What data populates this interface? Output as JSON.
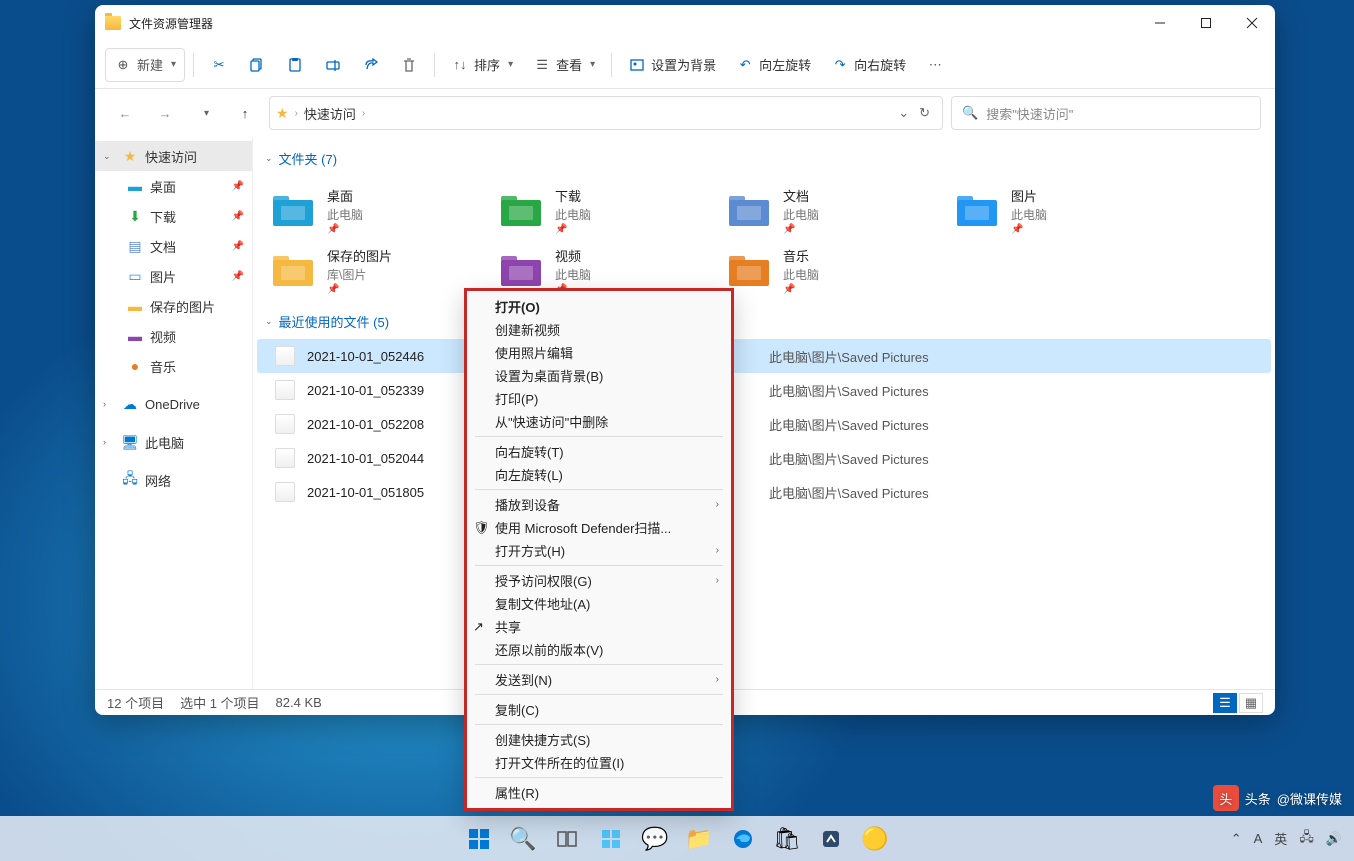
{
  "window": {
    "title": "文件资源管理器"
  },
  "toolbar": {
    "new": "新建",
    "sort": "排序",
    "view": "查看",
    "set_bg": "设置为背景",
    "rotate_left": "向左旋转",
    "rotate_right": "向右旋转"
  },
  "breadcrumb": {
    "root": "快速访问"
  },
  "search": {
    "placeholder": "搜索\"快速访问\""
  },
  "sidebar": {
    "quick": "快速访问",
    "desktop": "桌面",
    "downloads": "下载",
    "documents": "文档",
    "pictures": "图片",
    "saved_pictures": "保存的图片",
    "videos": "视频",
    "music": "音乐",
    "onedrive": "OneDrive",
    "this_pc": "此电脑",
    "network": "网络"
  },
  "groups": {
    "folders": "文件夹 (7)",
    "recent": "最近使用的文件 (5)"
  },
  "folders": [
    {
      "name": "桌面",
      "sub": "此电脑",
      "color": "#1ea1d6"
    },
    {
      "name": "下载",
      "sub": "此电脑",
      "color": "#28a745"
    },
    {
      "name": "文档",
      "sub": "此电脑",
      "color": "#5b8bd0"
    },
    {
      "name": "图片",
      "sub": "此电脑",
      "color": "#2196f3"
    },
    {
      "name": "保存的图片",
      "sub": "库\\图片",
      "color": "#f5b841"
    },
    {
      "name": "视频",
      "sub": "此电脑",
      "color": "#8e44ad"
    },
    {
      "name": "音乐",
      "sub": "此电脑",
      "color": "#e67e22"
    }
  ],
  "files": [
    {
      "name": "2021-10-01_052446",
      "path": "此电脑\\图片\\Saved Pictures",
      "selected": true
    },
    {
      "name": "2021-10-01_052339",
      "path": "此电脑\\图片\\Saved Pictures"
    },
    {
      "name": "2021-10-01_052208",
      "path": "此电脑\\图片\\Saved Pictures"
    },
    {
      "name": "2021-10-01_052044",
      "path": "此电脑\\图片\\Saved Pictures"
    },
    {
      "name": "2021-10-01_051805",
      "path": "此电脑\\图片\\Saved Pictures"
    }
  ],
  "context": {
    "open": "打开(O)",
    "create_video": "创建新视频",
    "edit_photos": "使用照片编辑",
    "set_desktop_bg": "设置为桌面背景(B)",
    "print": "打印(P)",
    "remove_quick": "从\"快速访问\"中删除",
    "rotate_right": "向右旋转(T)",
    "rotate_left": "向左旋转(L)",
    "cast": "播放到设备",
    "defender": "使用 Microsoft Defender扫描...",
    "open_with": "打开方式(H)",
    "grant_access": "授予访问权限(G)",
    "copy_path": "复制文件地址(A)",
    "share": "共享",
    "restore": "还原以前的版本(V)",
    "send_to": "发送到(N)",
    "copy": "复制(C)",
    "shortcut": "创建快捷方式(S)",
    "open_location": "打开文件所在的位置(I)",
    "properties": "属性(R)"
  },
  "status": {
    "items": "12 个项目",
    "selected": "选中 1 个项目",
    "size": "82.4 KB"
  },
  "tray": {
    "ime1": "A",
    "ime2": "英"
  },
  "watermark": "@微课传媒",
  "watermark_prefix": "头条"
}
